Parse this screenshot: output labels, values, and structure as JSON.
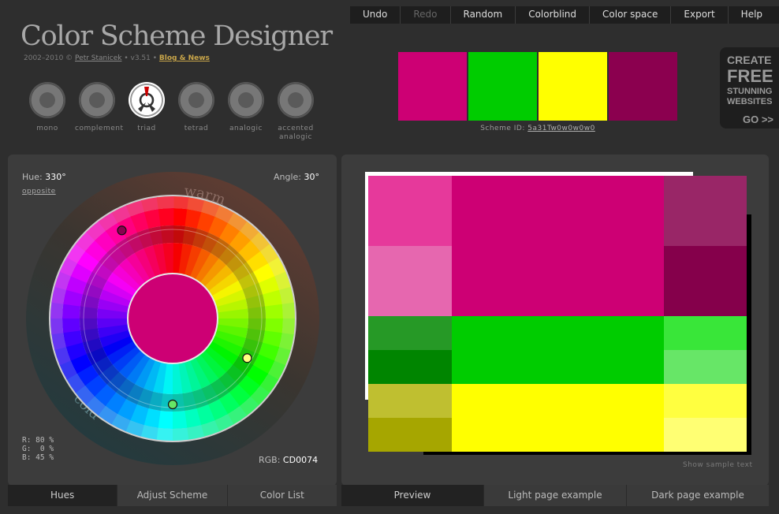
{
  "header": {
    "logo": "Color Scheme Designer",
    "years": "2002–2010 ©",
    "author": "Petr Stanicek",
    "version": "• v3.51 •",
    "blog": "Blog & News"
  },
  "menu": [
    {
      "label": "Undo",
      "disabled": false
    },
    {
      "label": "Redo",
      "disabled": true
    },
    {
      "label": "Random",
      "disabled": false
    },
    {
      "label": "Colorblind",
      "disabled": false
    },
    {
      "label": "Color space",
      "disabled": false
    },
    {
      "label": "Export",
      "disabled": false
    },
    {
      "label": "Help",
      "disabled": false
    }
  ],
  "modes": [
    {
      "label": "mono",
      "active": false
    },
    {
      "label": "complement",
      "active": false
    },
    {
      "label": "triad",
      "active": true
    },
    {
      "label": "tetrad",
      "active": false
    },
    {
      "label": "analogic",
      "active": false
    },
    {
      "label": "accented analogic",
      "active": false
    }
  ],
  "swatches": [
    "#CD0074",
    "#00CC00",
    "#FFFF00",
    "#8B004F"
  ],
  "scheme": {
    "id_label": "Scheme ID:",
    "id_value": "5a31Tw0w0w0w0"
  },
  "ad": {
    "l1": "CREATE",
    "l2": "FREE",
    "l3": "STUNNING",
    "l4": "WEBSITES",
    "go": "GO >>"
  },
  "wheel_panel": {
    "hue_label": "Hue:",
    "hue_value": "330°",
    "angle_label": "Angle:",
    "angle_value": "30°",
    "opposite": "opposite",
    "warm": "warm",
    "cold": "cold",
    "rgb_label": "RGB:",
    "rgb_value": "CD0074",
    "r": "R: 80 %",
    "g": "G:  0 %",
    "b": "B: 45 %",
    "center_color": "#CD0074",
    "tabs": [
      {
        "label": "Hues",
        "active": true
      },
      {
        "label": "Adjust Scheme",
        "active": false
      },
      {
        "label": "Color List",
        "active": false
      }
    ]
  },
  "preview_panel": {
    "show_sample": "Show sample text",
    "tabs": [
      {
        "label": "Preview",
        "active": true
      },
      {
        "label": "Light page example",
        "active": false
      },
      {
        "label": "Dark page example",
        "active": false
      }
    ],
    "grid": {
      "primary": {
        "main": "#CD0074",
        "left": [
          "#E6399B",
          "#E667AF"
        ],
        "right": [
          "#992667",
          "#85004B"
        ]
      },
      "secondary": {
        "main": "#00CC00",
        "left": [
          "#269926",
          "#008500"
        ],
        "right": [
          "#39E639",
          "#67E667"
        ]
      },
      "tertiary": {
        "main": "#FFFF00",
        "left": [
          "#BFBF30",
          "#A6A600"
        ],
        "right": [
          "#FFFF40",
          "#FFFF73"
        ]
      }
    }
  }
}
